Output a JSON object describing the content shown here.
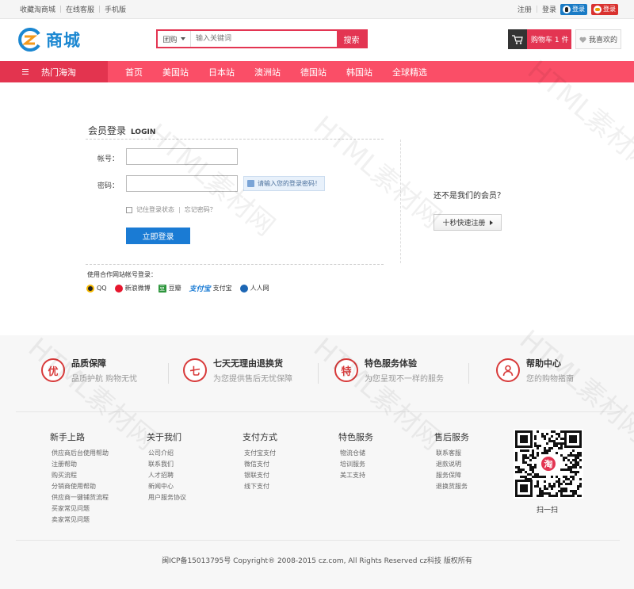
{
  "topbar": {
    "links": [
      "收藏淘商城",
      "在线客服",
      "手机版"
    ],
    "register": "注册",
    "login": "登录",
    "qq_login": "登录",
    "weibo_login": "登录"
  },
  "header": {
    "logo_text": "商城",
    "search": {
      "type_label": "团购",
      "placeholder": "输入关键词",
      "button": "搜索"
    },
    "cart": {
      "label": "购物车 1 件"
    },
    "favorites": {
      "label": "我喜欢的"
    }
  },
  "nav": {
    "category": "热门海淘",
    "items": [
      "首页",
      "美国站",
      "日本站",
      "澳洲站",
      "德国站",
      "韩国站",
      "全球精选"
    ]
  },
  "login": {
    "title_cn": "会员登录",
    "title_en": "LOGIN",
    "account_label": "帐号：",
    "password_label": "密码：",
    "password_tip": "请输入您的登录密码！",
    "remember": "记住登录状态",
    "forgot": "忘记密码？",
    "submit": "立即登录",
    "partner_title": "使用合作网站帐号登录：",
    "partners": [
      "QQ",
      "新浪微博",
      "豆瓣",
      "支付宝",
      "人人网"
    ],
    "partner_badges": {
      "douban": "豆",
      "alipay": "支付宝"
    },
    "register_question": "还不是我们的会员？",
    "register_button": "十秒快速注册"
  },
  "services": [
    {
      "icon": "优",
      "title": "品质保障",
      "subtitle": "品质护航 购物无忧"
    },
    {
      "icon": "七",
      "title": "七天无理由退换货",
      "subtitle": "为您提供售后无忧保障"
    },
    {
      "icon": "特",
      "title": "特色服务体验",
      "subtitle": "为您呈现不一样的服务"
    },
    {
      "icon": "user-icon",
      "title": "帮助中心",
      "subtitle": "您的购物指南"
    }
  ],
  "footer": {
    "columns": [
      {
        "title": "新手上路",
        "links": [
          "供应商后台使用帮助",
          "注册帮助",
          "购买流程",
          "分销商使用帮助",
          "供应商一键铺货流程",
          "买家常见问题",
          "卖家常见问题"
        ]
      },
      {
        "title": "关于我们",
        "links": [
          "公司介绍",
          "联系我们",
          "人才招聘",
          "新闻中心",
          "用户服务协议"
        ]
      },
      {
        "title": "支付方式",
        "links": [
          "支付宝支付",
          "微信支付",
          "银联支付",
          "线下支付"
        ]
      },
      {
        "title": "特色服务",
        "links": [
          "物流仓储",
          "培训服务",
          "美工支持"
        ]
      },
      {
        "title": "售后服务",
        "links": [
          "联系客服",
          "退款说明",
          "服务保障",
          "退换货服务"
        ]
      }
    ],
    "qr_badge": "淘",
    "qr_label": "扫一扫",
    "copyright": "闽ICP备15013795号 Copyright® 2008-2015 cz.com, All Rights Reserved cz科技 版权所有"
  },
  "watermark": "HTML素材网",
  "colors": {
    "accent": "#e33552",
    "nav": "#fa4e67",
    "nav_dark": "#e3344f",
    "brand": "#1b87d1",
    "button_blue": "#1a7bd4",
    "service_red": "#d83a3a"
  }
}
